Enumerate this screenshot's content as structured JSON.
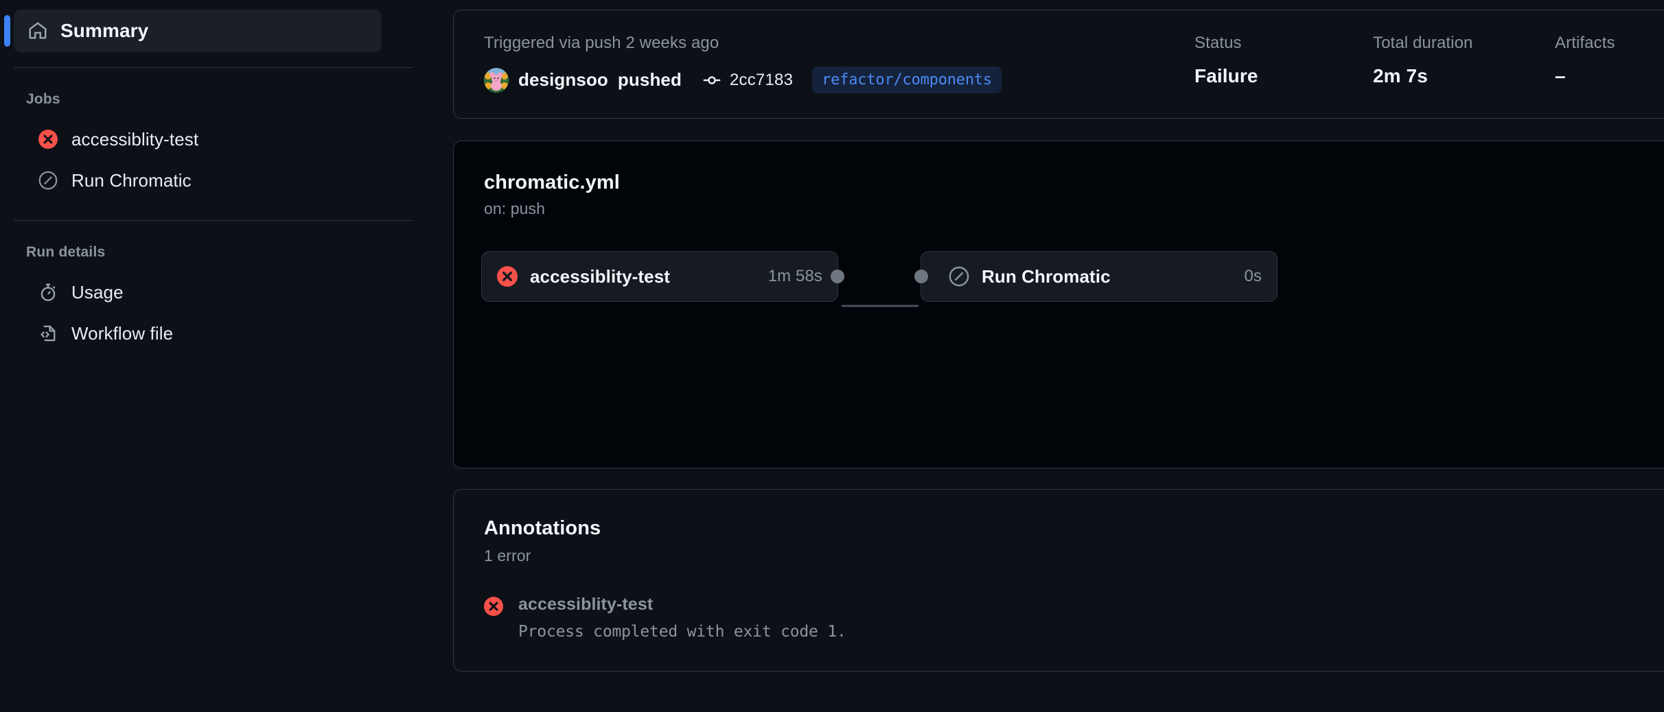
{
  "sidebar": {
    "summary": {
      "label": "Summary",
      "icon": "home-icon"
    },
    "jobs_heading": "Jobs",
    "jobs": [
      {
        "label": "accessiblity-test",
        "icon": "failure-icon",
        "status": "failure"
      },
      {
        "label": "Run Chromatic",
        "icon": "skipped-icon",
        "status": "skipped"
      }
    ],
    "run_details_heading": "Run details",
    "run_details": [
      {
        "label": "Usage",
        "icon": "stopwatch-icon"
      },
      {
        "label": "Workflow file",
        "icon": "file-code-icon"
      }
    ]
  },
  "header": {
    "trigger_text": "Triggered via push 2 weeks ago",
    "actor": "designsoo",
    "action": "pushed",
    "commit_sha": "2cc7183",
    "branch": "refactor/components",
    "commit_icon": "git-commit-icon",
    "avatar": "user-avatar",
    "stats": [
      {
        "label": "Status",
        "value": "Failure"
      },
      {
        "label": "Total duration",
        "value": "2m 7s"
      },
      {
        "label": "Artifacts",
        "value": "–"
      }
    ]
  },
  "graph": {
    "title": "chromatic.yml",
    "subtitle": "on: push",
    "nodes": [
      {
        "name": "accessiblity-test",
        "duration": "1m 58s",
        "icon": "failure-icon",
        "status": "failure"
      },
      {
        "name": "Run Chromatic",
        "duration": "0s",
        "icon": "skipped-icon",
        "status": "skipped"
      }
    ]
  },
  "annotations": {
    "title": "Annotations",
    "count_text": "1 error",
    "items": [
      {
        "job": "accessiblity-test",
        "message": "Process completed with exit code 1.",
        "icon": "failure-icon"
      }
    ]
  },
  "colors": {
    "page_bg": "#0d1117",
    "card_border": "#30363d",
    "graph_bg": "#010409",
    "node_bg": "#161b22",
    "accent_blue": "#3b82f6",
    "branch_text": "#4a8bf5",
    "failure_red": "#f85149",
    "muted_text": "#8b949e",
    "primary_text": "#f0f6fc"
  }
}
